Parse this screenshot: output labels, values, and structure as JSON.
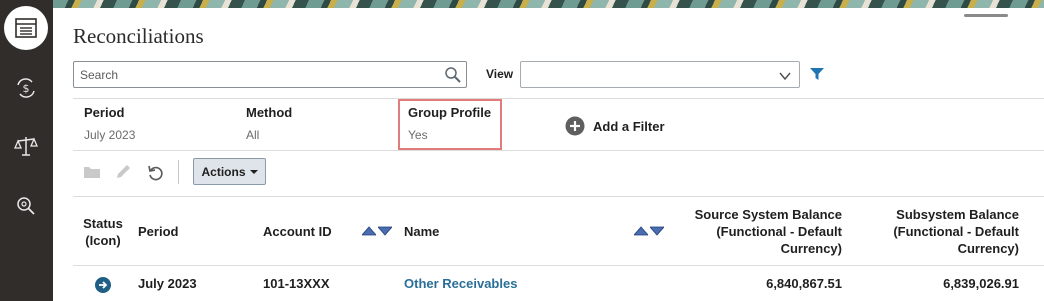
{
  "page": {
    "title": "Reconciliations"
  },
  "search": {
    "placeholder": "Search"
  },
  "view": {
    "label": "View",
    "value": ""
  },
  "filters": [
    {
      "label": "Period",
      "value": "July 2023"
    },
    {
      "label": "Method",
      "value": "All"
    },
    {
      "label": "Group Profile",
      "value": "Yes"
    }
  ],
  "add_filter": {
    "label": "Add a Filter"
  },
  "toolbar": {
    "actions_label": "Actions"
  },
  "table": {
    "columns": {
      "status_line1": "Status",
      "status_line2": "(Icon)",
      "period": "Period",
      "account_id": "Account ID",
      "name": "Name",
      "source_line1": "Source System Balance",
      "source_line2": "(Functional - Default",
      "source_line3": "Currency)",
      "sub_line1": "Subsystem Balance",
      "sub_line2": "(Functional - Default",
      "sub_line3": "Currency)"
    },
    "rows": [
      {
        "period": "July 2023",
        "account_id": "101-13XXX",
        "name": "Other Receivables",
        "source_balance": "6,840,867.51",
        "subsystem_balance": "6,839,026.91"
      }
    ]
  },
  "colors": {
    "accent": "#1f74b3",
    "rail": "#312d2a",
    "highlight": "#e07c7c",
    "link": "#2a6f99"
  },
  "icons": [
    "list-icon",
    "currency-exchange-icon",
    "balance-scale-icon",
    "search-settings-icon",
    "search-icon",
    "chevron-down-icon",
    "filter-icon",
    "plus-circle-icon",
    "folder-icon",
    "pencil-icon",
    "refresh-icon",
    "sort-asc-icon",
    "sort-desc-icon",
    "arrow-right-circle-icon"
  ]
}
